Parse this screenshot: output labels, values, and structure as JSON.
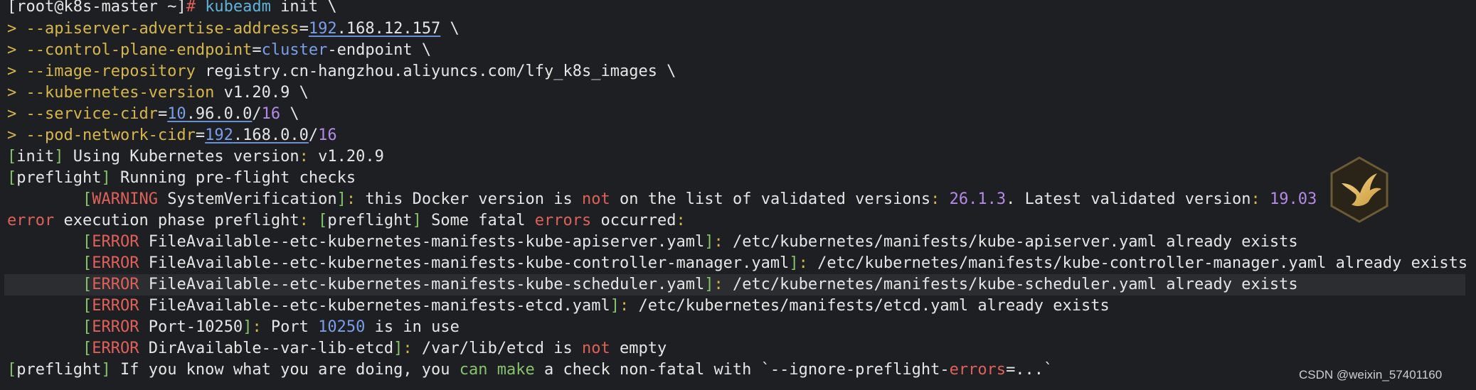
{
  "terminal": {
    "prompt": {
      "bracket_open": "[",
      "user_host": "root@k8s-master",
      "path": " ~",
      "bracket_close": "]",
      "symbol": "# ",
      "cmd": "kubeadm",
      "rest": " init \\"
    },
    "args": {
      "l1": {
        "gt": "> ",
        "flag": "--apiserver-advertise-address",
        "eq": "=",
        "v1": "192",
        "v2": ".168.12.157",
        "tail": " \\"
      },
      "l2": {
        "gt": "> ",
        "flag": "--control-plane-endpoint",
        "eq": "=",
        "v1": "cluster",
        "v2": "-endpoint",
        "tail": " \\"
      },
      "l3": {
        "gt": "> ",
        "flag": "--image-repository",
        "v": " registry.cn-hangzhou.aliyuncs.com/lfy_k8s_images",
        "tail": " \\"
      },
      "l4": {
        "gt": "> ",
        "flag": "--kubernetes-version",
        "v": " v1.20.9",
        "tail": " \\"
      },
      "l5": {
        "gt": "> ",
        "flag": "--service-cidr",
        "eq": "=",
        "v1": "10",
        "v2": ".96.0.0",
        "slash": "/",
        "v3": "16",
        "tail": " \\"
      },
      "l6": {
        "gt": "> ",
        "flag": "--pod-network-cidr",
        "eq": "=",
        "v1": "192",
        "v2": ".168.0.0",
        "slash": "/",
        "v3": "16"
      }
    },
    "init": {
      "open": "[",
      "tag": "init",
      "close": "]",
      "text": " Using Kubernetes version",
      "colon": ":",
      "version": " v1.20.9"
    },
    "preflight": {
      "open": "[",
      "tag": "preflight",
      "close": "]",
      "text": " Running pre-flight checks"
    },
    "warning": {
      "open": "[",
      "tag": "WARNING",
      "name": " SystemVerification",
      "close": "]",
      "colon": ":",
      "t1": " this Docker version is ",
      "not": "not",
      "t2": " on the list of validated versions",
      "colon2": ": ",
      "ver": "26.1.3",
      "t3": ". Latest validated version",
      "colon3": ": ",
      "ver2": "19.03"
    },
    "error_phase": {
      "error": "error",
      "t1": " execution phase preflight",
      "colon": ":",
      "open": " [",
      "tag": "preflight",
      "close": "]",
      "t2": " Some fatal ",
      "errors": "errors",
      "t3": " occurred",
      "colon2": ":"
    },
    "errors": {
      "e1": {
        "open": "[",
        "tag": "ERROR",
        "name": " FileAvailable--etc-kubernetes-manifests-kube-apiserver.yaml",
        "close": "]",
        "colon": ":",
        "text": " /etc/kubernetes/manifests/kube-apiserver.yaml already exists"
      },
      "e2": {
        "open": "[",
        "tag": "ERROR",
        "name": " FileAvailable--etc-kubernetes-manifests-kube-controller-manager.yaml",
        "close": "]",
        "colon": ":",
        "text": " /etc/kubernetes/manifests/kube-controller-manager.yaml already exists"
      },
      "e3": {
        "open": "[",
        "tag": "ERROR",
        "name": " FileAvailable--etc-kubernetes-manifests-kube-scheduler.yaml",
        "close": "]",
        "colon": ":",
        "text": " /etc/kubernetes/manifests/kube-scheduler.yaml already exists"
      },
      "e4": {
        "open": "[",
        "tag": "ERROR",
        "name": " FileAvailable--etc-kubernetes-manifests-etcd.yaml",
        "close": "]",
        "colon": ":",
        "text": " /etc/kubernetes/manifests/etcd.yaml already exists"
      },
      "e5": {
        "open": "[",
        "tag": "ERROR",
        "name": " Port-10250",
        "close": "]",
        "colon": ":",
        "t1": " Port ",
        "port": "10250",
        "t2": " is in use"
      },
      "e6": {
        "open": "[",
        "tag": "ERROR",
        "name": " DirAvailable--var-lib-etcd",
        "close": "]",
        "colon": ":",
        "t1": " /var/lib/etcd is ",
        "not": "not",
        "t2": " empty"
      }
    },
    "hint": {
      "open": "[",
      "tag": "preflight",
      "close": "]",
      "t1": " If you know what you are doing, you ",
      "can": "can",
      "t2": " ",
      "make": "make",
      "t3": " a check non-fatal with `--ignore-preflight-",
      "errors": "errors",
      "t4": "=...`"
    }
  },
  "watermark": "CSDN @weixin_57401160",
  "icons": {
    "logo": "hummingbird-logo-icon"
  },
  "colors": {
    "background": "#1e1f22",
    "highlight_line": "#2b2d31",
    "text": "#e6e6e6",
    "flag_yellow": "#d7b74a",
    "bracket_green": "#86c36b",
    "command_cyan": "#5fb3d7",
    "number_blue": "#7a9fe8",
    "number_purple": "#b58ae6",
    "error_red": "#e0605a"
  }
}
